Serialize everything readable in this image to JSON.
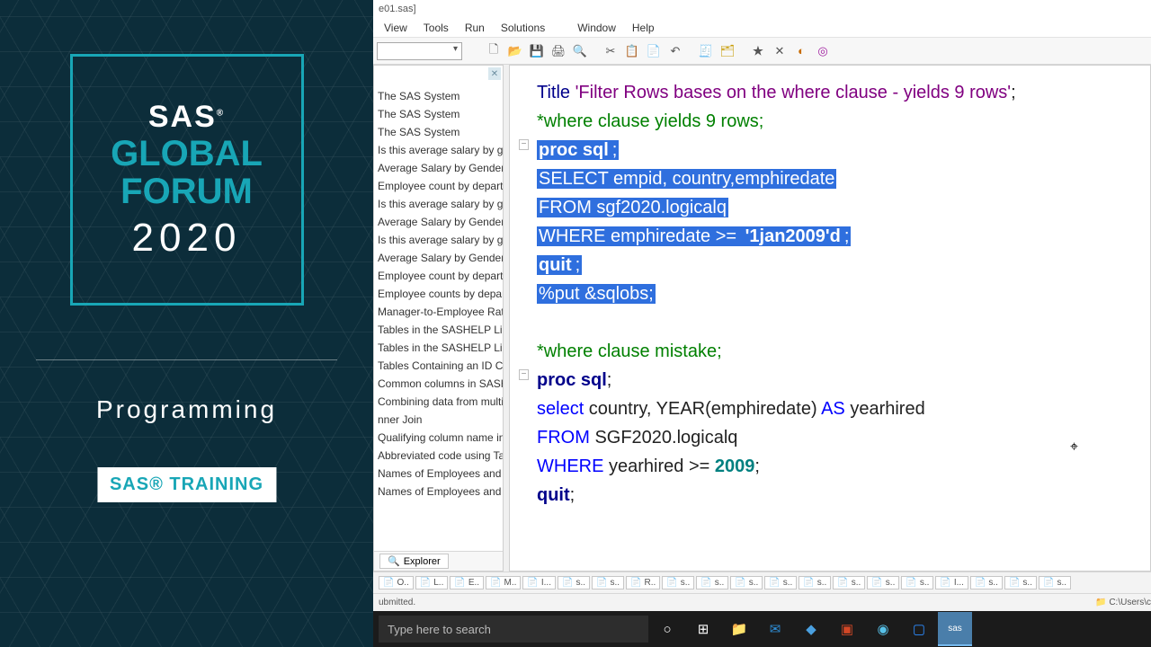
{
  "title_fragment": "e01.sas]",
  "menu": [
    "View",
    "Tools",
    "Run",
    "Solutions",
    "Window",
    "Help"
  ],
  "results": [
    "The SAS System",
    "The SAS System",
    "The SAS System",
    "Is this average salary by ger",
    "Average Salary by Gender",
    "Employee count by departm",
    "Is this average salary by ger",
    "Average Salary by Gender",
    "Is this average salary by ger",
    "Average Salary by Gender",
    "Employee count by departm",
    "Employee counts by departr",
    "Manager-to-Employee Ratic",
    "Tables in the SASHELP Libra",
    "Tables in the SASHELP Libra",
    "Tables Containing an ID Col",
    "Common columns in SASH",
    "Combining data from multi",
    "nner Join",
    "Qualifying column name in",
    "Abbreviated code using Tab",
    "Names of Employees and th",
    "Names of Employees and th"
  ],
  "explorer_tab": "Explorer",
  "code": {
    "l1a": "Title ",
    "l1b": "'Filter Rows bases on the where clause - yields 9 rows'",
    "l1c": ";",
    "l2": "*where clause yields 9 rows;",
    "l3a": "proc sql",
    "l3b": ";",
    "l4": "    SELECT empid, country,emphiredate",
    "l5": "       FROM sgf2020.logicalq",
    "l6a": "          WHERE emphiredate >= ",
    "l6b": "'1jan2009'd",
    "l6c": ";",
    "l7a": "quit",
    "l7b": ";",
    "l8": "%put &sqlobs;",
    "l10": "*where clause mistake;",
    "l11a": "proc sql",
    "l11b": ";",
    "l12a": "    ",
    "l12b": "select",
    "l12c": " country, YEAR(emphiredate) ",
    "l12d": "AS",
    "l12e": " yearhired",
    "l13a": "       ",
    "l13b": "FROM",
    "l13c": " SGF2020.logicalq",
    "l14a": "          ",
    "l14b": "WHERE",
    "l14c": " yearhired >= ",
    "l14d": "2009",
    "l14e": ";",
    "l15a": "quit",
    "l15b": ";"
  },
  "bottom_tabs": [
    "O..",
    "L..",
    "E..",
    "M..",
    "I...",
    "s..",
    "s..",
    "R..",
    "s..",
    "s..",
    "s..",
    "s..",
    "s..",
    "s..",
    "s..",
    "s..",
    "I...",
    "s..",
    "s..",
    "s.."
  ],
  "status_left": "ubmitted.",
  "status_right": "C:\\Users\\c",
  "taskbar_search": "Type here to search",
  "brand": {
    "sas": "SAS",
    "gf1": "GLOBAL",
    "gf2": "FORUM",
    "year": "2020",
    "prog": "Programming",
    "badge": "SAS® TRAINING",
    "reg": "®"
  }
}
